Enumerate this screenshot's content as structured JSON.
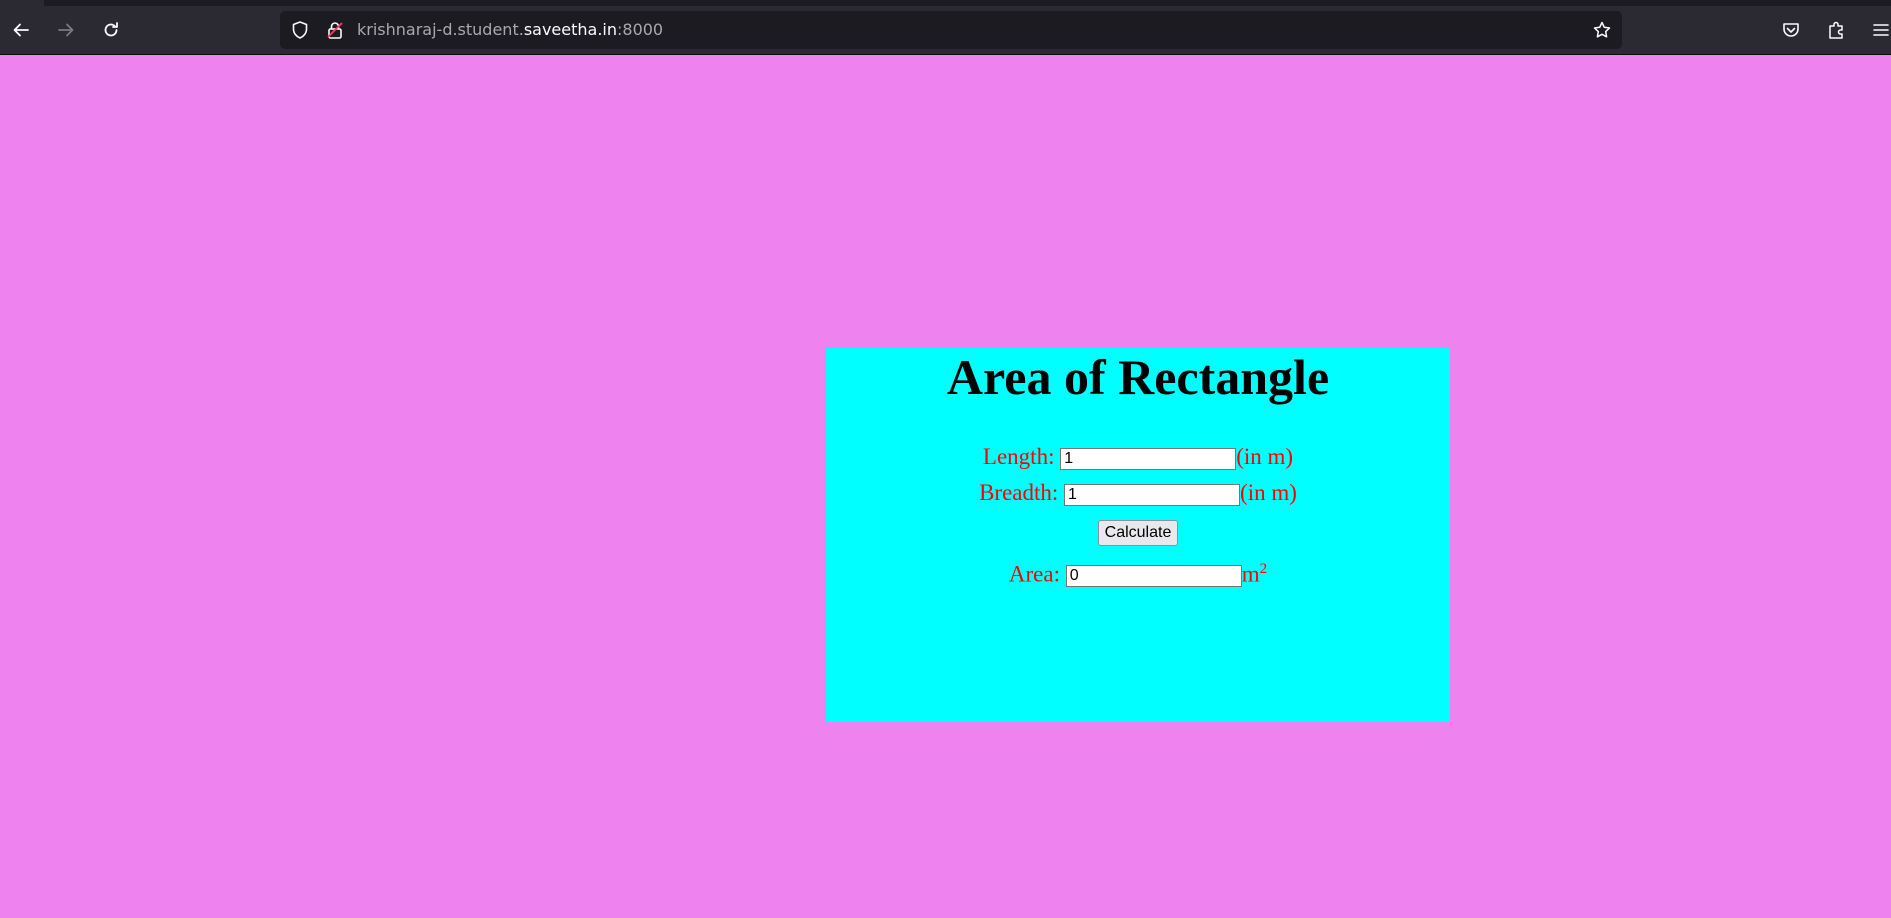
{
  "browser": {
    "url_prefix": "krishnaraj-d.student.",
    "url_host": "saveetha.in",
    "url_suffix": ":8000"
  },
  "colors": {
    "page_background": "#ee82ee",
    "card_background": "#00ffff",
    "label_color": "#ff0000",
    "heading_color": "#000000"
  },
  "page": {
    "heading": "Area of Rectangle",
    "length": {
      "label": "Length:",
      "value": "1",
      "unit": "(in m)"
    },
    "breadth": {
      "label": "Breadth:",
      "value": "1",
      "unit": "(in m)"
    },
    "calculate_label": "Calculate",
    "area": {
      "label": "Area:",
      "value": "0",
      "unit": "m",
      "unit_exponent": "2"
    }
  },
  "icons": {
    "back": "back-arrow-icon",
    "forward": "forward-arrow-icon",
    "reload": "reload-icon",
    "shield": "tracking-shield-icon",
    "lock": "insecure-lock-icon",
    "star": "bookmark-star-icon",
    "pocket": "pocket-icon",
    "extensions": "extensions-icon",
    "menu": "hamburger-menu-icon"
  }
}
